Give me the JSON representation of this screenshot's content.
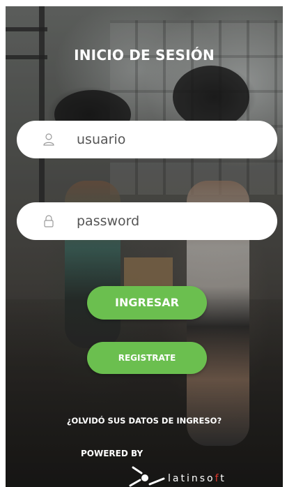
{
  "login": {
    "title": "INICIO DE SESIÓN",
    "username_value": "usuario",
    "password_value": "password",
    "login_button": "INGRESAR",
    "register_button": "REGISTRATE",
    "forgot_link": "¿OLVIDÓ SUS DATOS DE INGRESO?"
  },
  "footer": {
    "powered_by": "POWERED BY",
    "brand_prefix": "latinso",
    "brand_accent": "f",
    "brand_suffix": "t",
    "brand_icon": "latinsoft-logo-icon"
  },
  "icons": {
    "username": "user-icon",
    "password": "lock-icon"
  },
  "colors": {
    "button_green": "#6bbf4f",
    "field_background": "#ffffff",
    "text_white": "#ffffff",
    "brand_accent": "#e03a2f"
  }
}
